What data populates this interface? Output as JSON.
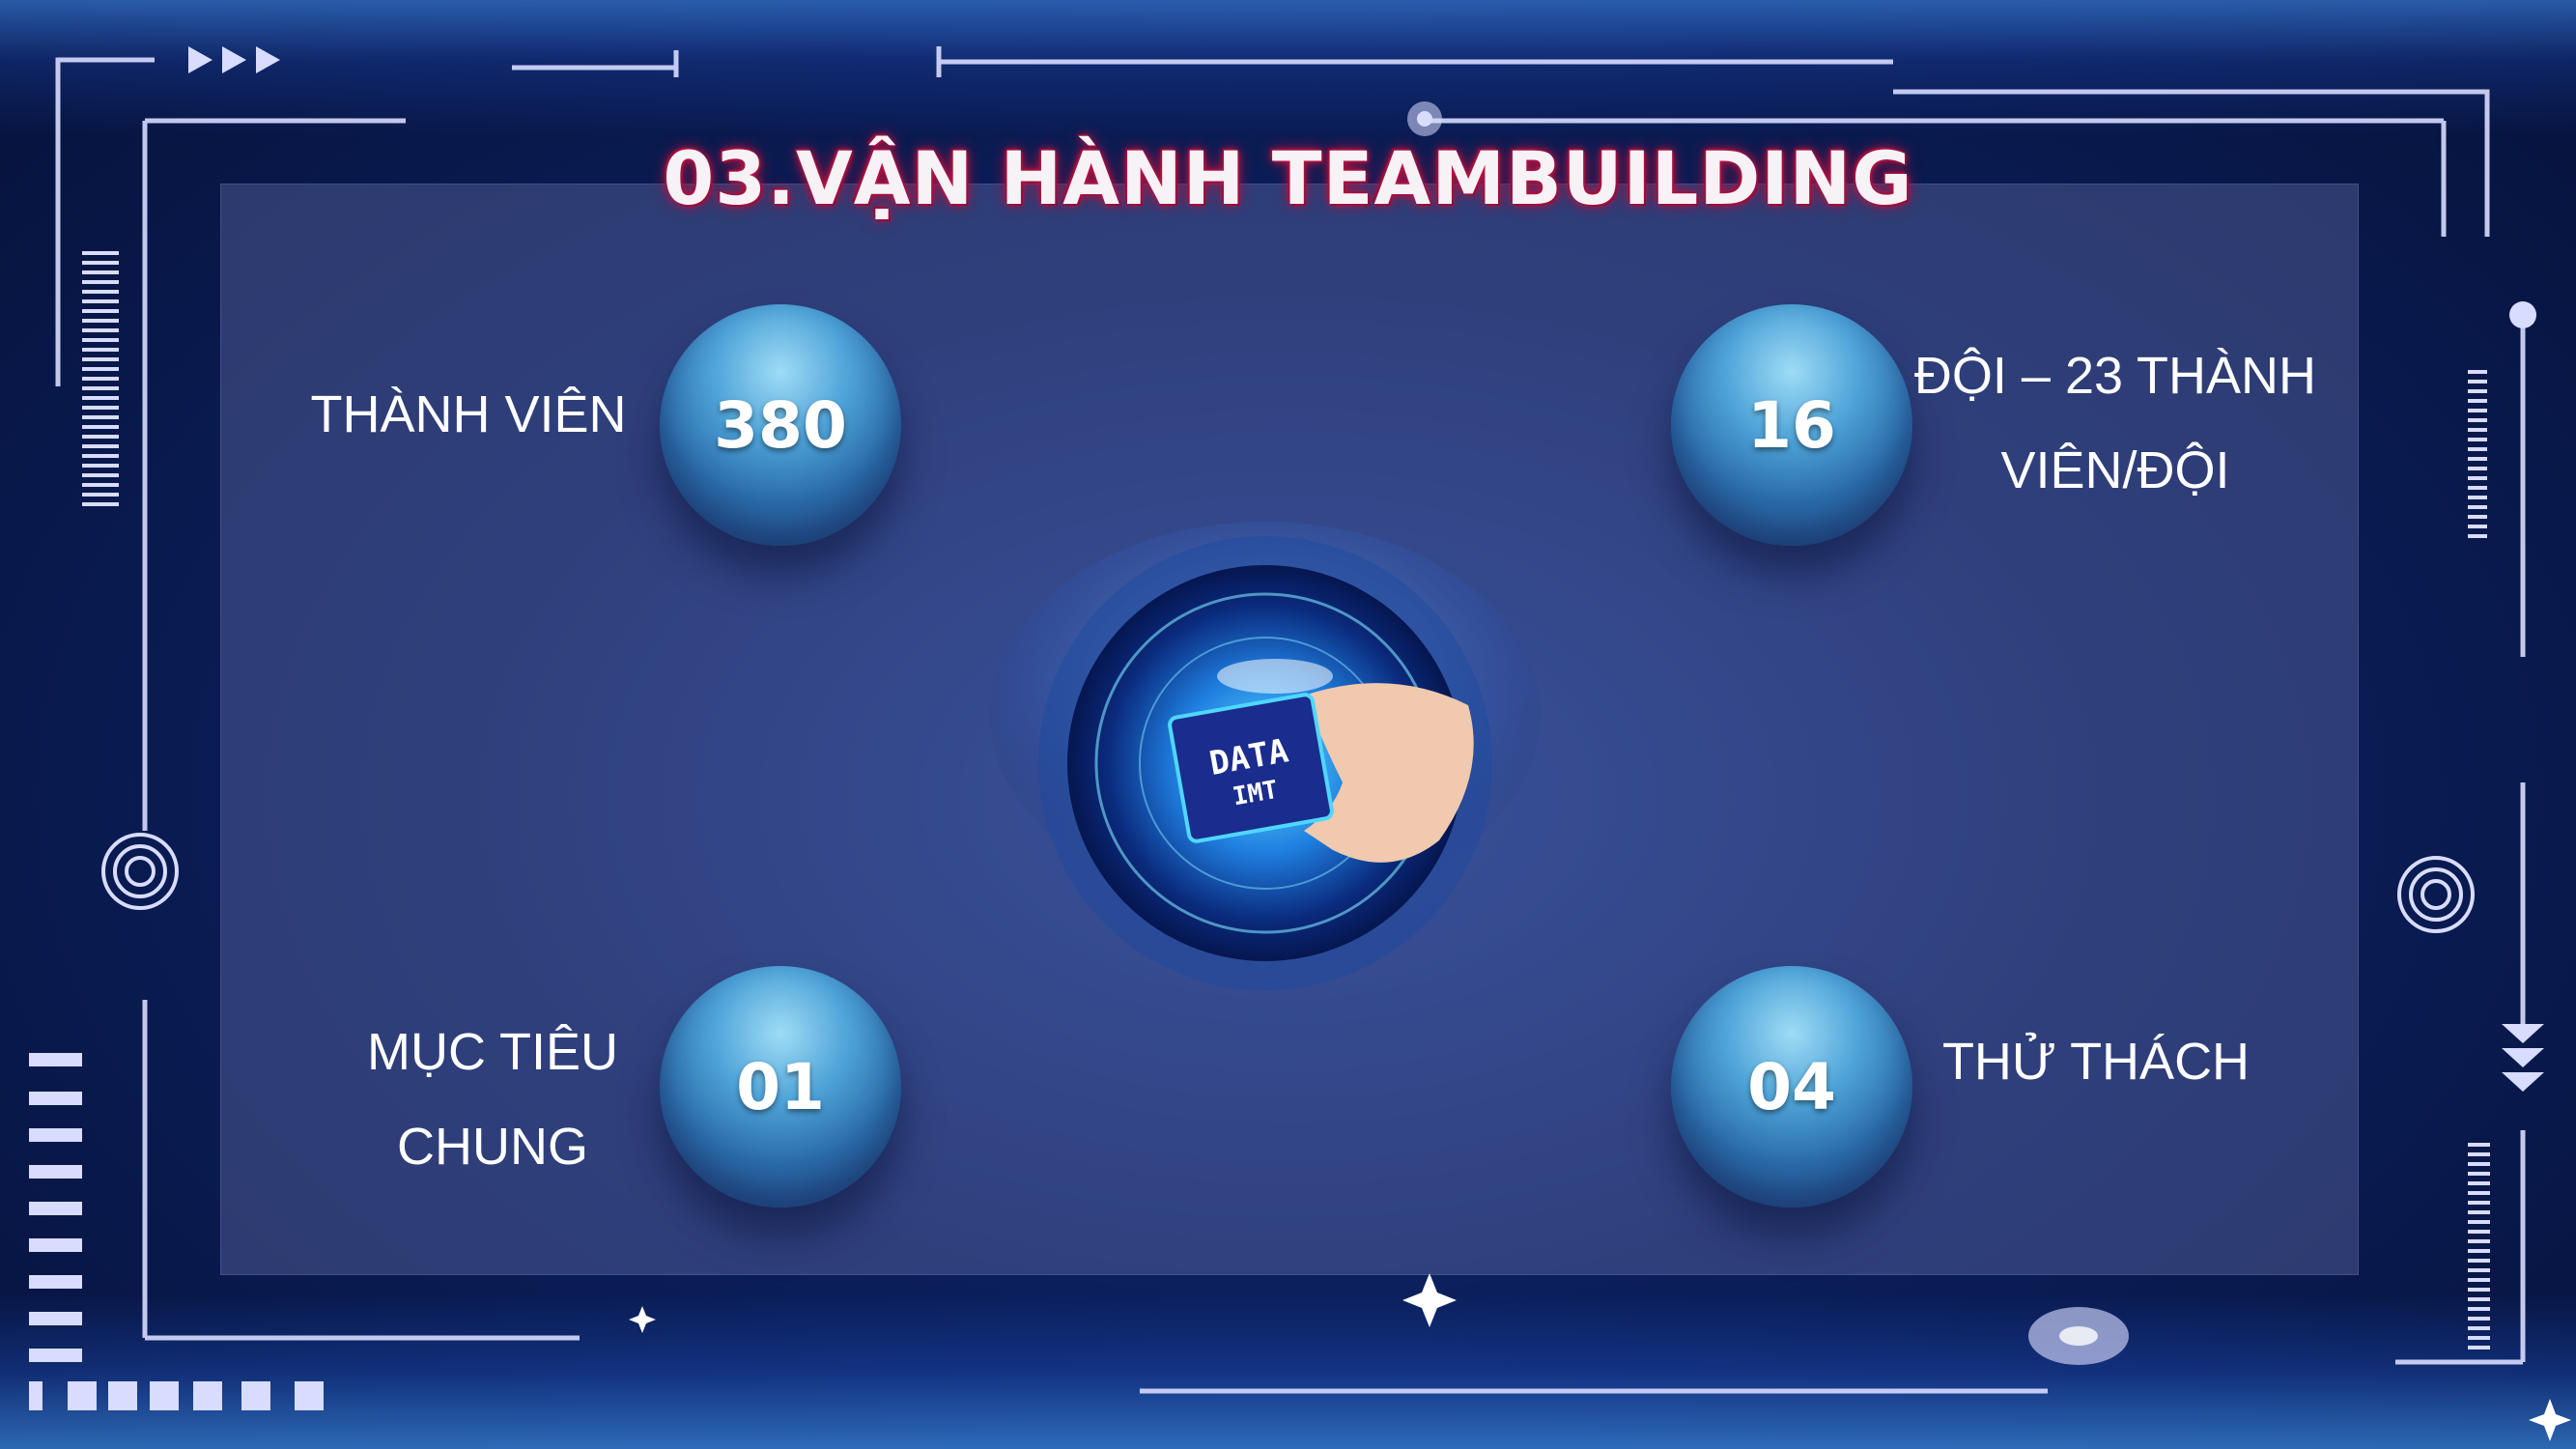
{
  "slide": {
    "title": "03.VẬN HÀNH TEAMBUILDING"
  },
  "stats": [
    {
      "number": "380",
      "label_line1": "THÀNH VIÊN",
      "label_line2": ""
    },
    {
      "number": "16",
      "label_line1": "ĐỘI – 23 THÀNH",
      "label_line2": "VIÊN/ĐỘI"
    },
    {
      "number": "01",
      "label_line1": "MỤC TIÊU",
      "label_line2": "CHUNG"
    },
    {
      "number": "04",
      "label_line1": "THỬ THÁCH",
      "label_line2": ""
    }
  ],
  "center_image": {
    "chip_line1": "DATA",
    "chip_line2": "IMT"
  },
  "colors": {
    "background": "#0b1f5c",
    "panel": "#6d76b0",
    "circle_accent": "#4ea3d8",
    "title_glow": "#c0184a",
    "frame_lines": "#d8dcff"
  }
}
